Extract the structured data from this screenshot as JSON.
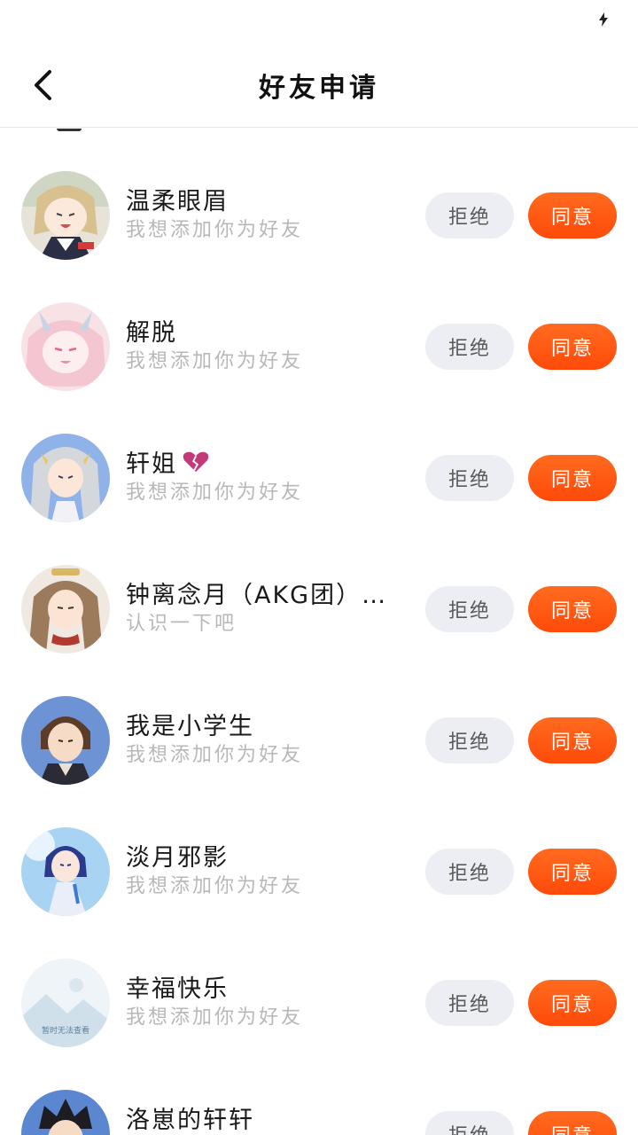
{
  "status_bar": {
    "charging_icon": "lightning-bolt"
  },
  "nav": {
    "title": "好友申请",
    "back_icon": "chevron-left"
  },
  "actions": {
    "reject_label": "拒绝",
    "accept_label": "同意"
  },
  "colors": {
    "accent": "#ff5a12",
    "reject_bg": "#eceef3",
    "subtitle": "#b8b8b8"
  },
  "requests": [
    {
      "name": "温柔眼眉",
      "message": "我想添加你为好友"
    },
    {
      "name": "解脱",
      "message": "我想添加你为好友"
    },
    {
      "name": "轩姐",
      "emoji": "broken-heart",
      "message": "我想添加你为好友"
    },
    {
      "name": "钟离念月（AKG团）…",
      "message": "认识一下吧"
    },
    {
      "name": "我是小学生",
      "message": "我想添加你为好友"
    },
    {
      "name": "淡月邪影",
      "message": "我想添加你为好友"
    },
    {
      "name": "幸福快乐",
      "message": "我想添加你为好友",
      "avatar_placeholder": "暂时无法查看"
    },
    {
      "name": "洛崽的轩轩",
      "message": ""
    }
  ]
}
